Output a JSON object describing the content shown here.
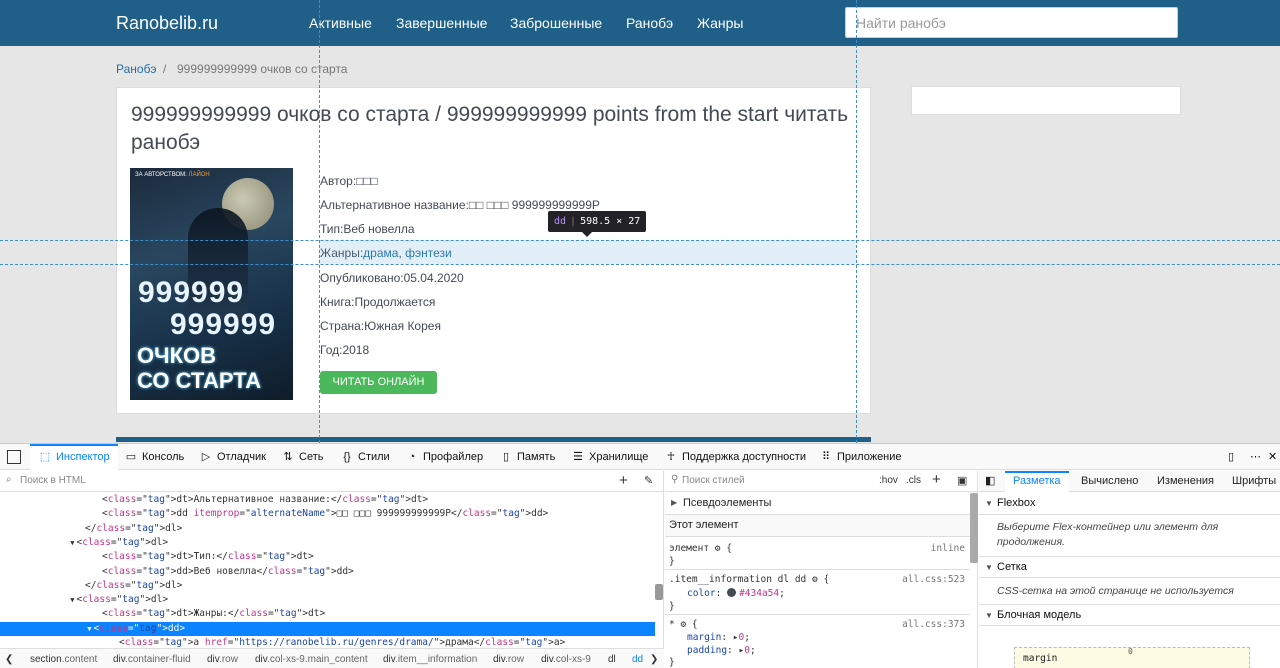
{
  "site": {
    "brand": "Ranobelib.ru",
    "nav": [
      "Активные",
      "Завершенные",
      "Заброшенные",
      "Ранобэ",
      "Жанры"
    ],
    "search_placeholder": "Найти ранобэ",
    "breadcrumb": [
      "Ранобэ",
      "/",
      "999999999999 очков со старта"
    ]
  },
  "novel": {
    "title": "999999999999 очков со старта / 999999999999 points from the start читать ранобэ",
    "cover": {
      "topline_prefix": "ЗА АВТОРСТВОМ:",
      "topline_author": "ЛАЙОН",
      "num1": "999999",
      "num2": "999999",
      "big1": "ОЧКОВ",
      "big2": "СО СТАРТА"
    },
    "author_label": "Автор:",
    "author_value": "□□□",
    "alt_label": "Альтернативное название:",
    "alt_value": "□□ □□□ 999999999999P",
    "type_label": "Тип:",
    "type_value": "Веб новелла",
    "genres_label": "Жанры:",
    "genre1": "драма",
    "genre_sep": ", ",
    "genre2": "фэнтези",
    "published_label": "Опубликовано:",
    "published_value": "05.04.2020",
    "book_label": "Книга:",
    "book_value": "Продолжается",
    "country_label": "Страна:",
    "country_value": "Южная Корея",
    "year_label": "Год:",
    "year_value": "2018",
    "read_button": "ЧИТАТЬ ОНЛАЙН"
  },
  "tooltip": {
    "tag": "dd",
    "size": "598.5 × 27"
  },
  "devtools": {
    "tabs": [
      "Инспектор",
      "Консоль",
      "Отладчик",
      "Сеть",
      "Стили",
      "Профайлер",
      "Память",
      "Хранилище",
      "Поддержка доступности",
      "Приложение"
    ],
    "html_search_placeholder": "Поиск в HTML",
    "code_lines": [
      {
        "indent": "            ",
        "pre": "",
        "html": "<dt>Альтернативное название:</dt>"
      },
      {
        "indent": "            ",
        "pre": "",
        "html": "<dd itemprop=\"alternateName\">□□ □□□ 999999999999P</dd>"
      },
      {
        "indent": "          ",
        "pre": "",
        "html": "</dl>"
      },
      {
        "indent": "         ",
        "pre": "▼",
        "html": "<dl>"
      },
      {
        "indent": "            ",
        "pre": "",
        "html": "<dt>Тип:</dt>"
      },
      {
        "indent": "            ",
        "pre": "",
        "html": "<dd>Веб новелла</dd>"
      },
      {
        "indent": "          ",
        "pre": "",
        "html": "</dl>"
      },
      {
        "indent": "         ",
        "pre": "▼",
        "html": "<dl>"
      },
      {
        "indent": "            ",
        "pre": "",
        "html": "<dt>Жанры:</dt>"
      },
      {
        "indent": "           ",
        "pre": "▼",
        "html": "<dd>"
      },
      {
        "indent": "              ",
        "pre": "",
        "html": "<a href=\"https://ranobelib.ru/genres/drama/\">драма</a>"
      }
    ],
    "breadcrumbs": [
      {
        "tag": "section",
        "cls": ".content"
      },
      {
        "tag": "div",
        "cls": ".container-fluid"
      },
      {
        "tag": "div",
        "cls": ".row"
      },
      {
        "tag": "div",
        "cls": ".col-xs-9.main_content"
      },
      {
        "tag": "div",
        "cls": ".item__information"
      },
      {
        "tag": "div",
        "cls": ".row"
      },
      {
        "tag": "div",
        "cls": ".col-xs-9"
      },
      {
        "tag": "dl",
        "cls": ""
      },
      {
        "tag": "dd",
        "cls": ""
      }
    ],
    "styles": {
      "filter_placeholder": "Поиск стилей",
      "hov": ":hov",
      "cls": ".cls",
      "pseudo": "Псевдоэлементы",
      "this_element": "Этот элемент",
      "rule1_selector": "элемент",
      "rule1_src": "inline",
      "rule2_selector": ".item__information dl dd",
      "rule2_src": "all.css:523",
      "rule2_prop": "color",
      "rule2_value": "#434a54",
      "rule3_selector": "*",
      "rule3_src": "all.css:373",
      "rule3_prop1": "margin",
      "rule3_val1": "0",
      "rule3_prop2": "padding",
      "rule3_val2": "0"
    },
    "layout": {
      "tabs": [
        "Разметка",
        "Вычислено",
        "Изменения",
        "Шрифты"
      ],
      "flexbox": "Flexbox",
      "flexbox_text": "Выберите Flex-контейнер или элемент для продолжения.",
      "grid": "Сетка",
      "grid_text": "CSS-сетка на этой странице не используется",
      "box_model": "Блочная модель",
      "margin_label": "margin",
      "margin_top": "0"
    }
  },
  "colors": {
    "nav_bg": "#1f5f88",
    "accent": "#0a84ff",
    "button_green": "#4cb85c",
    "text": "#434a54"
  }
}
